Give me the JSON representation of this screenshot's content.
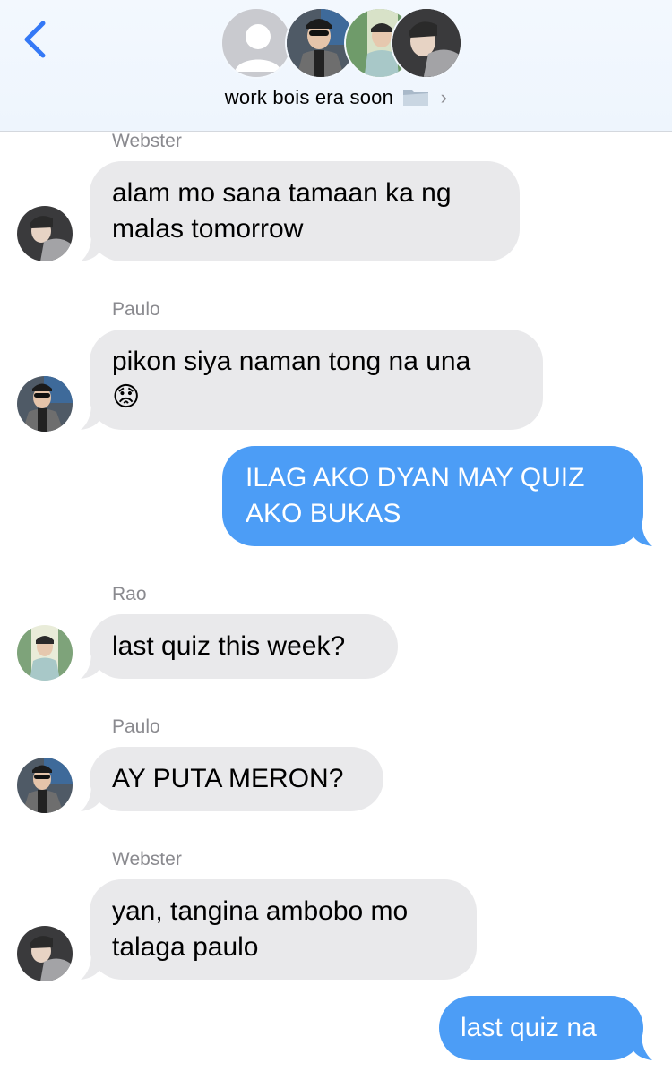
{
  "header": {
    "back_icon": "chevron-left-icon",
    "title": "work bois era soon",
    "title_icon": "folder-icon",
    "chevron_icon": "chevron-right-icon"
  },
  "messages": [
    {
      "sender": "Webster",
      "text1": "alam mo sana tamaan ka ng",
      "text2": "malas tomorrow"
    },
    {
      "sender": "Paulo",
      "text1": "pikon siya naman tong na una",
      "text2": "😟"
    },
    {
      "text1": "ILAG AKO DYAN MAY QUIZ",
      "text2": "AKO BUKAS"
    },
    {
      "sender": "Rao",
      "text1": "last quiz this week?"
    },
    {
      "sender": "Paulo",
      "text1": "AY PUTA MERON?"
    },
    {
      "sender": "Webster",
      "text1": "yan, tangina ambobo mo",
      "text2": "talaga paulo"
    },
    {
      "text1": "last quiz na"
    }
  ],
  "colors": {
    "accent": "#3478f6",
    "incoming": "#e9e9eb",
    "outgoing": "#4c9df6"
  }
}
